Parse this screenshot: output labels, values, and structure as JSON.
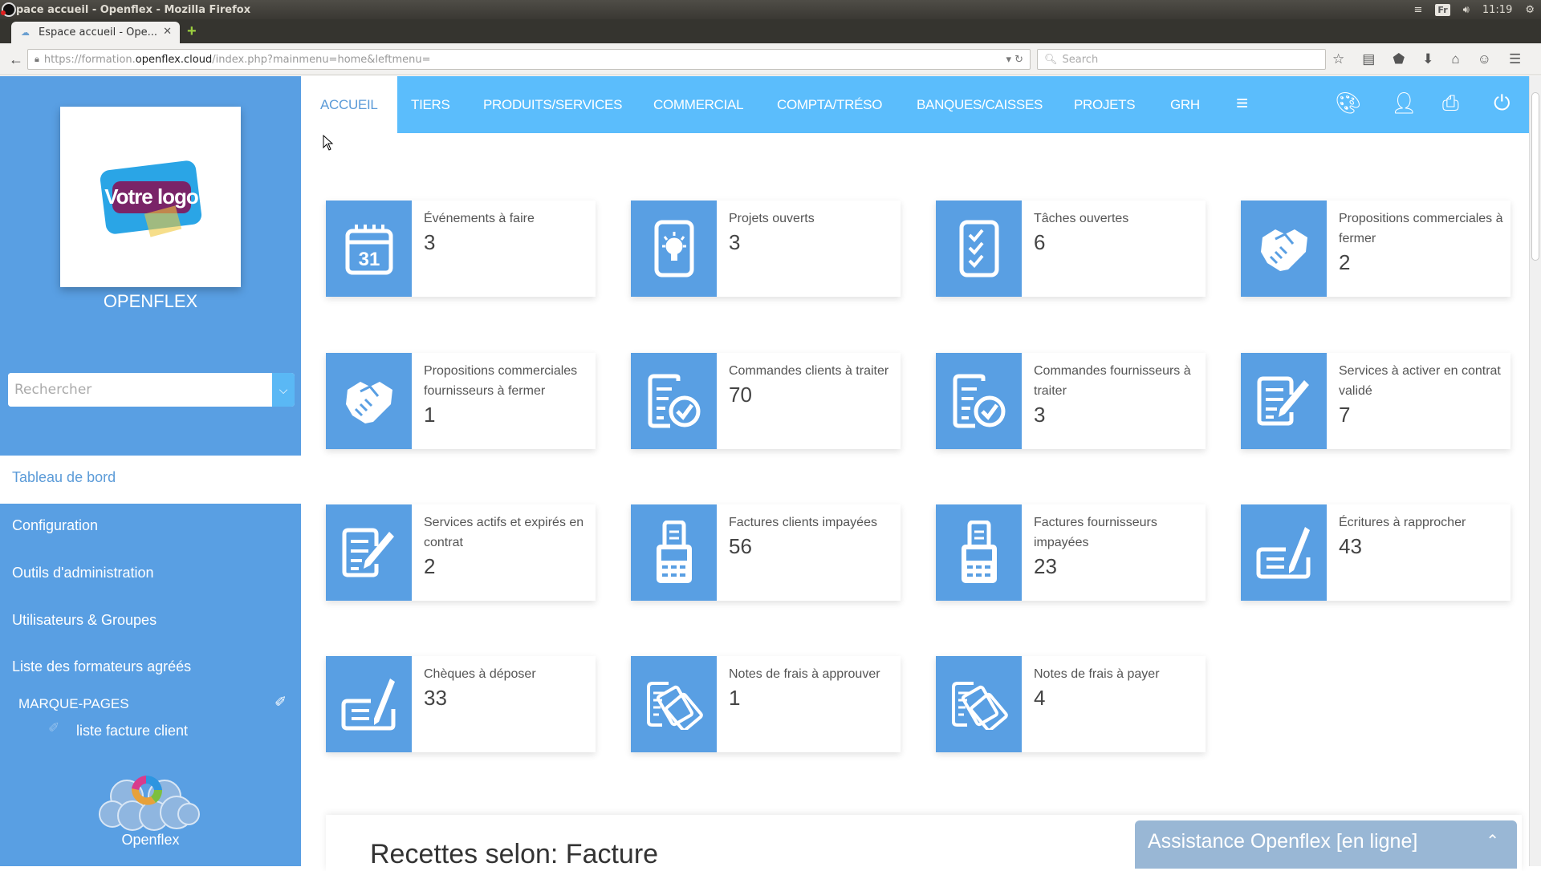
{
  "os": {
    "window_title": "pace accueil - Openflex - Mozilla Firefox",
    "keyboard_layout": "Fr",
    "clock": "11:19"
  },
  "browser": {
    "tab_title": "Espace accueil - Ope...",
    "url_prefix": "https://formation.",
    "url_host": "openflex.cloud",
    "url_path": "/index.php?mainmenu=home&leftmenu=",
    "search_placeholder": "Search",
    "icons": [
      "star-icon",
      "reading-list-icon",
      "pocket-icon",
      "download-icon",
      "home-icon",
      "chat-icon",
      "hamburger-menu-icon"
    ]
  },
  "sidebar": {
    "logo_text": "Votre logo",
    "company_name": "OPENFLEX",
    "search_placeholder": "Rechercher",
    "active_item": "Tableau de bord",
    "items": [
      {
        "label": "Configuration"
      },
      {
        "label": "Outils d'administration"
      },
      {
        "label": "Utilisateurs & Groupes"
      },
      {
        "label": "Liste des formateurs agréés"
      }
    ],
    "bookmarks_title": "MARQUE-PAGES",
    "bookmarks": [
      {
        "label": "liste facture client"
      }
    ],
    "footer_label": "Openflex"
  },
  "topnav": {
    "items": [
      {
        "label": "ACCUEIL",
        "active": true
      },
      {
        "label": "TIERS"
      },
      {
        "label": "PRODUITS/SERVICES"
      },
      {
        "label": "COMMERCIAL"
      },
      {
        "label": "COMPTA/TRÉSO"
      },
      {
        "label": "BANQUES/CAISSES"
      },
      {
        "label": "PROJETS"
      },
      {
        "label": "GRH"
      }
    ],
    "icons": [
      "hamburger-icon",
      "palette-icon",
      "user-icon",
      "print-icon",
      "power-icon"
    ]
  },
  "cards": [
    {
      "label": "Événements à faire",
      "value": "3",
      "icon": "calendar-icon"
    },
    {
      "label": "Projets ouverts",
      "value": "3",
      "icon": "lightbulb-icon"
    },
    {
      "label": "Tâches ouvertes",
      "value": "6",
      "icon": "checklist-icon"
    },
    {
      "label": "Propositions commerciales à fermer",
      "value": "2",
      "icon": "handshake-icon"
    },
    {
      "label": "Propositions commerciales fournisseurs à fermer",
      "value": "1",
      "icon": "handshake-icon"
    },
    {
      "label": "Commandes clients à traiter",
      "value": "70",
      "icon": "order-check-icon"
    },
    {
      "label": "Commandes fournisseurs à traiter",
      "value": "3",
      "icon": "order-check-icon"
    },
    {
      "label": "Services à activer en contrat validé",
      "value": "7",
      "icon": "contract-edit-icon"
    },
    {
      "label": "Services actifs et expirés en contrat",
      "value": "2",
      "icon": "contract-edit-icon"
    },
    {
      "label": "Factures clients impayées",
      "value": "56",
      "icon": "payment-terminal-icon"
    },
    {
      "label": "Factures fournisseurs impayées",
      "value": "23",
      "icon": "payment-terminal-icon"
    },
    {
      "label": "Écritures à rapprocher",
      "value": "43",
      "icon": "cheque-sign-icon"
    },
    {
      "label": "Chèques à déposer",
      "value": "33",
      "icon": "cheque-sign-icon"
    },
    {
      "label": "Notes de frais à approuver",
      "value": "1",
      "icon": "expense-notes-icon"
    },
    {
      "label": "Notes de frais à payer",
      "value": "4",
      "icon": "expense-notes-icon"
    }
  ],
  "revenue_title": "Recettes selon: Facture",
  "assistance": {
    "label": "Assistance Openflex [en ligne]"
  },
  "colors": {
    "sidebar": "#599fe3",
    "topnav": "#5bbdfc",
    "card_icon_bg": "#599fe3",
    "assist": "#99b7d5"
  }
}
